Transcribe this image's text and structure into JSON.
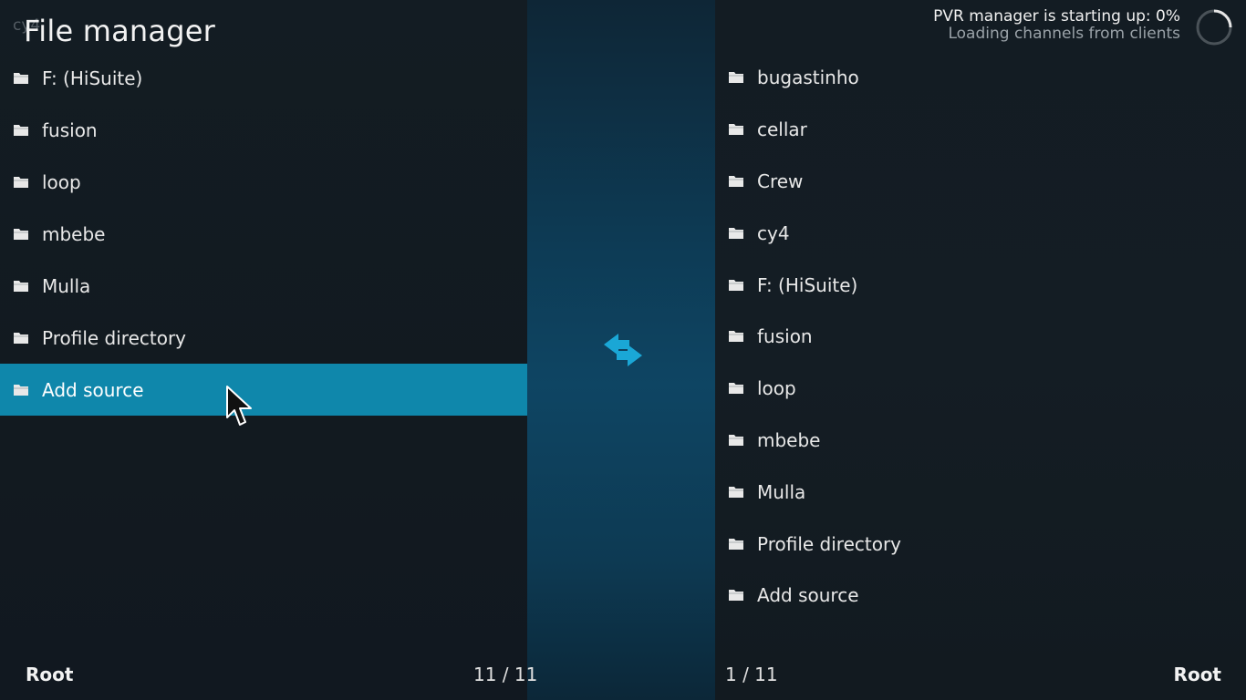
{
  "header": {
    "title": "File manager",
    "ghost_path": "cy4",
    "pvr_status": "PVR manager is starting up:  0%",
    "pvr_substatus": "Loading channels from clients"
  },
  "left_list": {
    "items": [
      {
        "label": "F: (HiSuite)",
        "icon": "folder-icon"
      },
      {
        "label": "fusion",
        "icon": "folder-icon"
      },
      {
        "label": "loop",
        "icon": "folder-icon"
      },
      {
        "label": "mbebe",
        "icon": "folder-icon"
      },
      {
        "label": "Mulla",
        "icon": "folder-icon"
      },
      {
        "label": "Profile directory",
        "icon": "folder-icon"
      },
      {
        "label": "Add source",
        "icon": "folder-icon",
        "selected": true
      }
    ]
  },
  "right_list": {
    "items": [
      {
        "label": "bugastinho",
        "icon": "folder-icon"
      },
      {
        "label": "cellar",
        "icon": "folder-icon"
      },
      {
        "label": "Crew",
        "icon": "folder-icon"
      },
      {
        "label": "cy4",
        "icon": "folder-icon"
      },
      {
        "label": "F: (HiSuite)",
        "icon": "folder-icon"
      },
      {
        "label": "fusion",
        "icon": "folder-icon"
      },
      {
        "label": "loop",
        "icon": "folder-icon"
      },
      {
        "label": "mbebe",
        "icon": "folder-icon"
      },
      {
        "label": "Mulla",
        "icon": "folder-icon"
      },
      {
        "label": "Profile directory",
        "icon": "folder-icon"
      },
      {
        "label": "Add source",
        "icon": "folder-icon"
      }
    ]
  },
  "footer": {
    "left_root": "Root",
    "left_count": "11 / 11",
    "right_count": "1 / 11",
    "right_root": "Root"
  },
  "colors": {
    "selection": "#0f87ab",
    "swap_icon": "#1aa7d6",
    "background": "#121a21"
  },
  "center": {
    "icon": "swap-arrows-icon"
  }
}
